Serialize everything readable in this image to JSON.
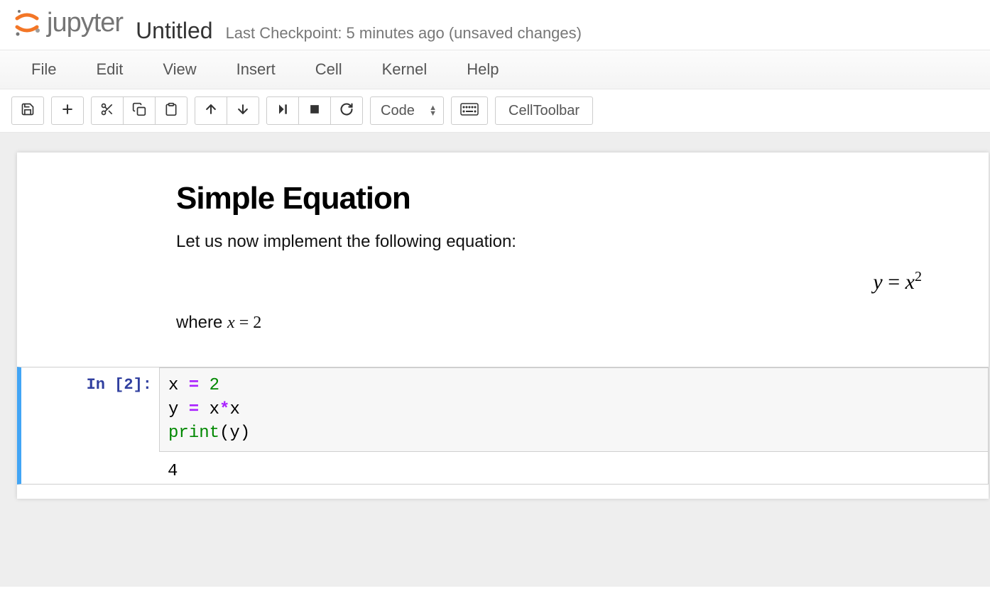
{
  "header": {
    "logo_text": "jupyter",
    "notebook_title": "Untitled",
    "checkpoint_info": "Last Checkpoint: 5 minutes ago (unsaved changes)"
  },
  "menu": {
    "file": "File",
    "edit": "Edit",
    "view": "View",
    "insert": "Insert",
    "cell": "Cell",
    "kernel": "Kernel",
    "help": "Help"
  },
  "toolbar": {
    "save_icon": "save",
    "add_icon": "add",
    "cut_icon": "cut",
    "copy_icon": "copy",
    "paste_icon": "paste",
    "up_icon": "up",
    "down_icon": "down",
    "run_icon": "run",
    "stop_icon": "stop",
    "restart_icon": "restart",
    "cell_type": "Code",
    "keyboard_icon": "keyboard",
    "cell_toolbar_label": "CellToolbar"
  },
  "markdown": {
    "heading": "Simple Equation",
    "intro": "Let us now implement the following equation:",
    "equation_y": "y",
    "equation_eq": " = ",
    "equation_x": "x",
    "equation_sup": "2",
    "where_prefix": "where ",
    "where_math_x": "x",
    "where_math_eq": " = ",
    "where_math_val": "2"
  },
  "code_cell": {
    "prompt_label": "In [",
    "prompt_num": "2",
    "prompt_close": "]:",
    "line1_var": "x",
    "line1_eq": " = ",
    "line1_val": "2",
    "line2_var": "y",
    "line2_eq": " = ",
    "line2_rhs_a": "x",
    "line2_star": "*",
    "line2_rhs_b": "x",
    "line3_fn": "print",
    "line3_open": "(",
    "line3_arg": "y",
    "line3_close": ")",
    "output": "4"
  }
}
